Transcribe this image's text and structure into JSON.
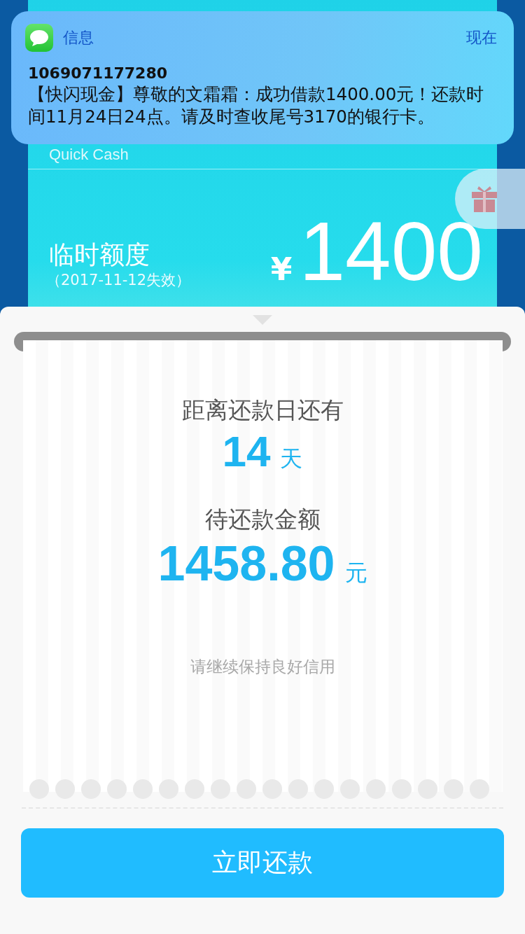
{
  "notification": {
    "app": "信息",
    "time": "现在",
    "sender": "1069071177280",
    "message": "【快闪现金】尊敬的文霜霜：成功借款1400.00元！还款时间11月24日24点。请及时查收尾号3170的银行卡。"
  },
  "card": {
    "brand": "Quick Cash",
    "label": "临时额度",
    "expiry": "（2017-11-12失效）",
    "currency": "¥",
    "amount": "1400"
  },
  "receipt": {
    "days_label": "距离还款日还有",
    "days": "14",
    "days_unit": "天",
    "amount_label": "待还款金额",
    "amount": "1458.80",
    "amount_unit": "元",
    "note": "请继续保持良好信用"
  },
  "button": "立即还款"
}
